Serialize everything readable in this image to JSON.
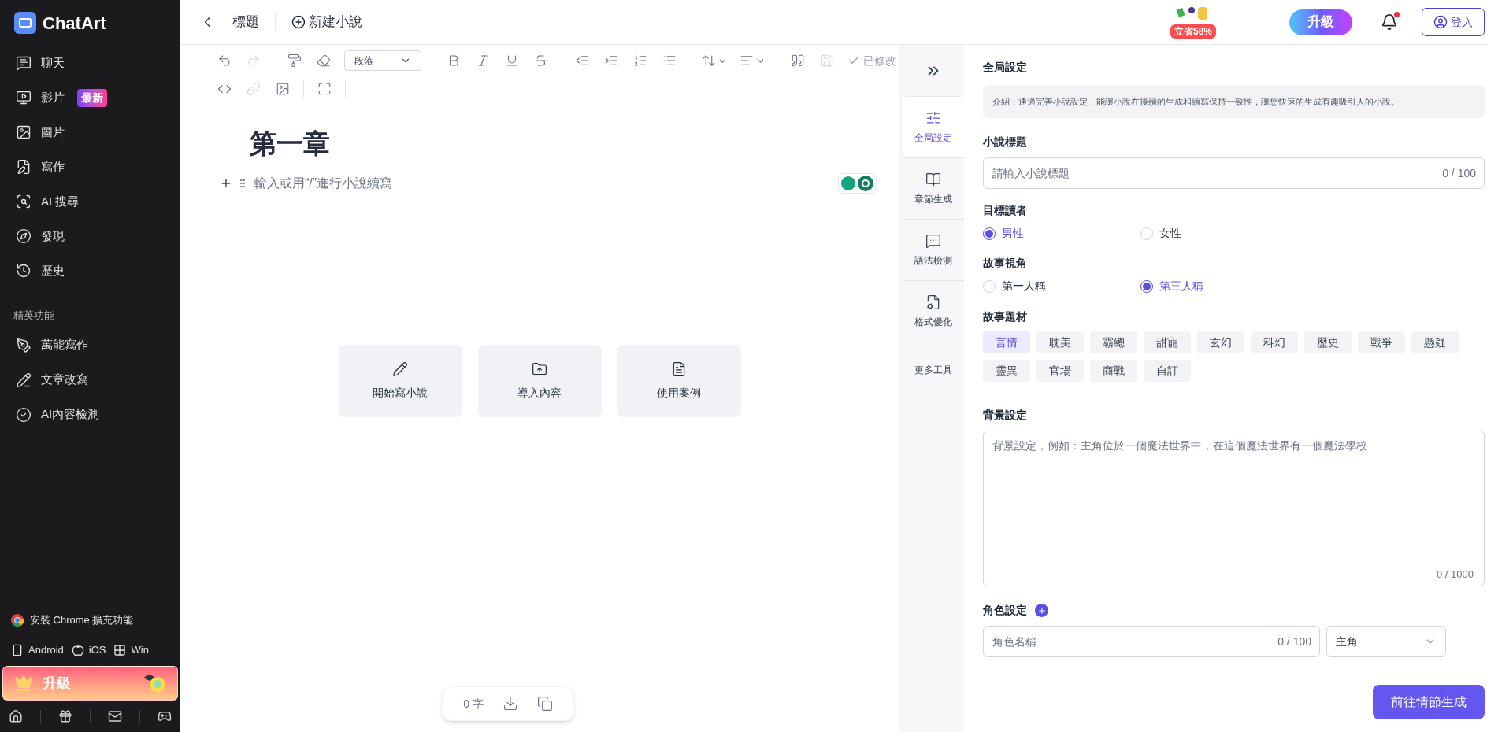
{
  "sidebar": {
    "logo": "ChatArt",
    "nav": [
      {
        "label": "聊天"
      },
      {
        "label": "影片",
        "badge": "最新"
      },
      {
        "label": "圖片"
      },
      {
        "label": "寫作"
      },
      {
        "label": "AI 搜尋"
      },
      {
        "label": "發現"
      },
      {
        "label": "歷史"
      }
    ],
    "section_title": "精英功能",
    "tools": [
      {
        "label": "萬能寫作"
      },
      {
        "label": "文章改寫"
      },
      {
        "label": "AI內容檢測"
      }
    ],
    "install": "安裝 Chrome 擴充功能",
    "platforms": [
      "Android",
      "iOS",
      "Win"
    ],
    "upgrade": "升級"
  },
  "topbar": {
    "title": "標題",
    "new_button": "新建小說",
    "promo": "立省58%",
    "upgrade": "升級",
    "notification_dot": true,
    "login": "登入"
  },
  "toolbar": {
    "rows": [
      [
        {
          "kind": "icon",
          "disabled": false
        },
        {
          "kind": "icon",
          "disabled": true
        },
        {
          "kind": "sep"
        },
        {
          "kind": "icon",
          "disabled": false
        },
        {
          "kind": "icon",
          "disabled": false
        },
        {
          "kind": "select",
          "value": "段落"
        },
        {
          "kind": "sep"
        },
        {
          "kind": "icon",
          "disabled": false
        },
        {
          "kind": "icon",
          "disabled": false
        },
        {
          "kind": "icon",
          "disabled": false
        },
        {
          "kind": "icon",
          "disabled": false
        },
        {
          "kind": "sep"
        },
        {
          "kind": "icon",
          "disabled": false
        },
        {
          "kind": "icon",
          "disabled": false
        },
        {
          "kind": "icon",
          "disabled": false
        },
        {
          "kind": "icon",
          "disabled": false
        },
        {
          "kind": "sep"
        },
        {
          "kind": "menu",
          "disabled": false
        },
        {
          "kind": "menu",
          "disabled": false
        },
        {
          "kind": "sep"
        },
        {
          "kind": "icon",
          "disabled": false
        },
        {
          "kind": "icon",
          "disabled": true
        },
        {
          "kind": "status",
          "label": "已修改"
        }
      ],
      [
        {
          "kind": "icon",
          "disabled": false
        },
        {
          "kind": "icon",
          "disabled": true
        },
        {
          "kind": "icon",
          "disabled": false
        },
        {
          "kind": "sep"
        },
        {
          "kind": "icon",
          "disabled": false
        },
        {
          "kind": "sep"
        }
      ]
    ]
  },
  "editor": {
    "heading": "第一章",
    "placeholder": "輸入或用“/”進行小說續寫",
    "actions": [
      "開始寫小說",
      "導入內容",
      "使用案例"
    ],
    "word_count": "0 字"
  },
  "tool_rail": {
    "items": [
      {
        "label": "全局設定",
        "selected": true
      },
      {
        "label": "章節生成",
        "selected": false
      },
      {
        "label": "語法檢測",
        "selected": false
      },
      {
        "label": "格式優化",
        "selected": false
      }
    ],
    "more": "更多工具"
  },
  "settings": {
    "title": "全局設定",
    "intro": "介紹：通過完善小說設定，能讓小說在後續的生成和續寫保持一致性，讓您快速的生成有趣吸引人的小說。",
    "novel_title": {
      "label": "小說標題",
      "placeholder": "請輸入小說標題",
      "counter": "0 / 100"
    },
    "radio_groups": [
      {
        "label": "目標讀者",
        "options": [
          {
            "label": "男性",
            "selected": true
          },
          {
            "label": "女性",
            "selected": false
          }
        ]
      },
      {
        "label": "故事視角",
        "options": [
          {
            "label": "第一人稱",
            "selected": false
          },
          {
            "label": "第三人稱",
            "selected": true
          }
        ]
      }
    ],
    "genre": {
      "label": "故事題材",
      "tags": [
        {
          "label": "言情",
          "selected": true
        },
        {
          "label": "耽美",
          "selected": false
        },
        {
          "label": "霸總",
          "selected": false
        },
        {
          "label": "甜寵",
          "selected": false
        },
        {
          "label": "玄幻",
          "selected": false
        },
        {
          "label": "科幻",
          "selected": false
        },
        {
          "label": "歷史",
          "selected": false
        },
        {
          "label": "戰爭",
          "selected": false
        },
        {
          "label": "懸疑",
          "selected": false
        },
        {
          "label": "靈異",
          "selected": false
        },
        {
          "label": "官場",
          "selected": false
        },
        {
          "label": "商戰",
          "selected": false
        },
        {
          "label": "自訂",
          "selected": false
        }
      ]
    },
    "background": {
      "label": "背景設定",
      "placeholder": "背景設定，例如：主角位於一個魔法世界中，在這個魔法世界有一個魔法學校",
      "counter": "0 / 1000"
    },
    "characters": {
      "label": "角色設定",
      "name_placeholder": "角色名稱",
      "counter": "0 / 100",
      "role": "主角"
    },
    "submit": "前往情節生成"
  }
}
